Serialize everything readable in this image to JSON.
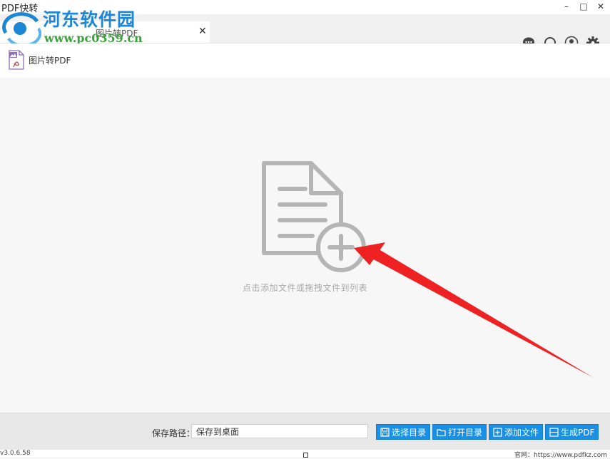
{
  "window": {
    "title": "PDF快转",
    "minimize": "–",
    "maximize": "□",
    "close": "✕"
  },
  "watermark": {
    "name": "河东软件园",
    "url": "www.pc0359.cn"
  },
  "tab": {
    "label": "图片转PDF",
    "close": "✕"
  },
  "toolbar": {
    "label": "图片转PDF"
  },
  "main": {
    "hint": "点击添加文件或拖拽文件到列表"
  },
  "bottom": {
    "path_label": "保存路径：",
    "path_value": "保存到桌面",
    "buttons": {
      "choose_dir": "选择目录",
      "open_dir": "打开目录",
      "add_file": "添加文件",
      "generate": "生成PDF"
    }
  },
  "status": {
    "version": "v3.0.6.58",
    "site": "官网：https://www.pdfkz.com"
  },
  "colors": {
    "accent": "#1a8fe6",
    "arrow": "#ee2222",
    "icon_gray": "#b5b5b5"
  }
}
